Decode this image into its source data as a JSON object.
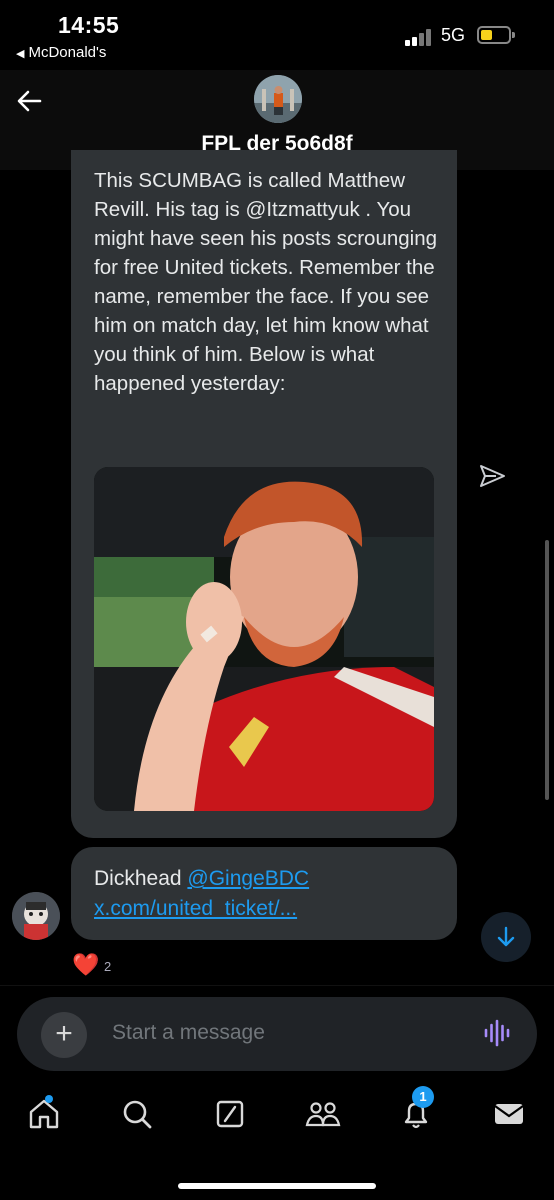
{
  "status": {
    "time": "14:55",
    "back_app": "McDonald's",
    "network": "5G"
  },
  "header": {
    "title": "FPL der 5o6d8f"
  },
  "messages": {
    "main_text": "This SCUMBAG is called Matthew Revill. His tag is @Itzmattyuk . You might have seen his posts scrounging for free United tickets. Remember the name, remember the face. If you see him on match day, let him know what you think of him. Below is what happened yesterday:",
    "reply_text": "Dickhead",
    "reply_mention": "@GingeBDC",
    "reply_link": "x.com/united_ticket/...",
    "reaction_emoji": "❤️",
    "reaction_count": "2"
  },
  "composer": {
    "placeholder": "Start a message",
    "plus": "+"
  },
  "tabs": {
    "notifications_badge": "1"
  },
  "colors": {
    "accent": "#1d9bf0",
    "bubble": "#2f3336",
    "background": "#000000"
  },
  "icons": [
    "back-arrow-icon",
    "share-icon",
    "plus-icon",
    "voice-icon",
    "scroll-down-icon",
    "home-icon",
    "search-icon",
    "grok-icon",
    "communities-icon",
    "bell-icon",
    "mail-icon"
  ]
}
